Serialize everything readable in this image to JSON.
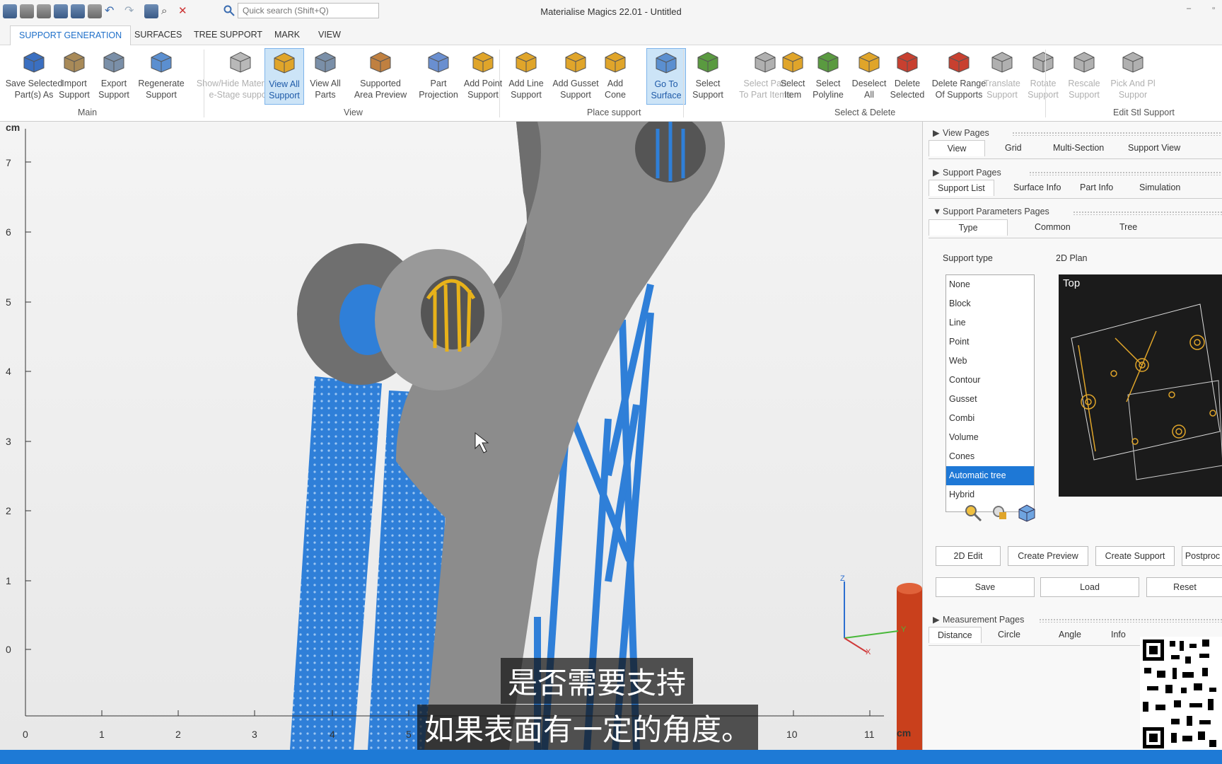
{
  "window": {
    "title": "Materialise Magics 22.01 - Untitled",
    "search_placeholder": "Quick search (Shift+Q)",
    "min_label": "–",
    "max_label": "▫"
  },
  "menu_tabs": [
    "SUPPORT GENERATION",
    "SURFACES",
    "TREE SUPPORT",
    "MARK",
    "VIEW"
  ],
  "ribbon": {
    "groups": [
      "Main",
      "View",
      "Place support",
      "Select & Delete",
      "Edit Stl Support"
    ],
    "buttons": [
      {
        "line1": "Save Selected",
        "line2": "Part(s) As",
        "icon": "save-icon"
      },
      {
        "line1": "Import",
        "line2": "Support",
        "icon": "import-icon"
      },
      {
        "line1": "Export",
        "line2": "Support",
        "icon": "export-icon"
      },
      {
        "line1": "Regenerate",
        "line2": "Support",
        "icon": "regenerate-icon"
      },
      {
        "line1": "Show/Hide Materialise",
        "line2": "e-Stage support",
        "icon": "estage-icon"
      },
      {
        "line1": "View All",
        "line2": "Support",
        "icon": "view-support-icon"
      },
      {
        "line1": "View All",
        "line2": "Parts",
        "icon": "view-parts-icon"
      },
      {
        "line1": "Supported",
        "line2": "Area Preview",
        "icon": "area-preview-icon"
      },
      {
        "line1": "Part",
        "line2": "Projection",
        "icon": "projection-icon"
      },
      {
        "line1": "Add Point",
        "line2": "Support",
        "icon": "add-point-icon"
      },
      {
        "line1": "Add Line",
        "line2": "Support",
        "icon": "add-line-icon"
      },
      {
        "line1": "Add Gusset",
        "line2": "Support",
        "icon": "add-gusset-icon"
      },
      {
        "line1": "Add",
        "line2": "Cone",
        "icon": "add-cone-icon"
      },
      {
        "line1": "Go To",
        "line2": "Surface",
        "icon": "goto-surface-icon"
      },
      {
        "line1": "Select",
        "line2": "Support",
        "icon": "select-support-icon"
      },
      {
        "line1": "Select Part",
        "line2": "To Part Items",
        "icon": "select-part-icon"
      },
      {
        "line1": "Select",
        "line2": "Item",
        "icon": "select-item-icon"
      },
      {
        "line1": "Select",
        "line2": "Polyline",
        "icon": "select-polyline-icon"
      },
      {
        "line1": "Deselect",
        "line2": "All",
        "icon": "deselect-icon"
      },
      {
        "line1": "Delete",
        "line2": "Selected",
        "icon": "delete-icon"
      },
      {
        "line1": "Delete Range",
        "line2": "Of Supports",
        "icon": "delete-range-icon"
      },
      {
        "line1": "Translate",
        "line2": "Support",
        "icon": "translate-icon"
      },
      {
        "line1": "Rotate",
        "line2": "Support",
        "icon": "rotate-icon"
      },
      {
        "line1": "Rescale",
        "line2": "Support",
        "icon": "rescale-icon"
      },
      {
        "line1": "Pick And Pl",
        "line2": "Suppor",
        "icon": "pick-place-icon"
      }
    ]
  },
  "viewport": {
    "unit": "cm",
    "y_ticks": [
      "7",
      "6",
      "5",
      "4",
      "3",
      "2",
      "1",
      "0"
    ],
    "x_ticks": [
      "0",
      "1",
      "2",
      "3",
      "4",
      "5",
      "10",
      "11"
    ],
    "axis_x": "X",
    "axis_y": "Y",
    "axis_z": "Z"
  },
  "panel": {
    "view_pages": "View Pages",
    "view_tabs": [
      "View",
      "Grid",
      "Multi-Section",
      "Support View"
    ],
    "support_pages": "Support Pages",
    "support_tabs": [
      "Support List",
      "Surface Info",
      "Part Info",
      "Simulation"
    ],
    "param_pages": "Support Parameters Pages",
    "param_tabs": [
      "Type",
      "Common",
      "Tree"
    ],
    "support_type_label": "Support type",
    "plan_label": "2D Plan",
    "plan_view": "Top",
    "support_types": [
      "None",
      "Block",
      "Line",
      "Point",
      "Web",
      "Contour",
      "Gusset",
      "Combi",
      "Volume",
      "Cones",
      "Automatic tree",
      "Hybrid"
    ],
    "selected_type": "Automatic tree",
    "buttons_row1": [
      "2D Edit",
      "Create Preview",
      "Create Support",
      "Postproc"
    ],
    "buttons_row2": [
      "Save",
      "Load",
      "Reset"
    ],
    "measure_pages": "Measurement Pages",
    "measure_tabs": [
      "Distance",
      "Circle",
      "Angle",
      "Info"
    ]
  },
  "subtitles": {
    "line1": "是否需要支持",
    "line2": "如果表面有一定的角度。"
  },
  "colors": {
    "accent": "#1e78d6",
    "support_blue": "#2f7fd8",
    "part_gray": "#8c8c8c",
    "selected_support": "#e8b21a"
  }
}
